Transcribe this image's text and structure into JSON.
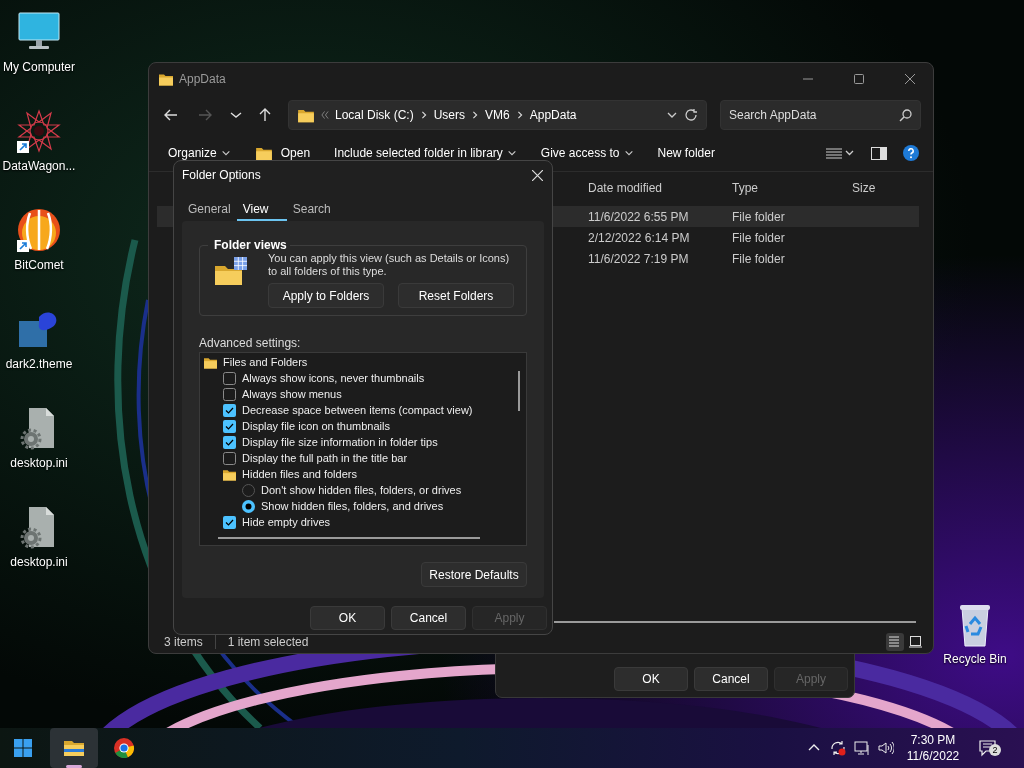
{
  "desktop_icons": [
    {
      "label": "My Computer",
      "kind": "monitor",
      "shortcut": false
    },
    {
      "label": "DataWagon...",
      "kind": "star",
      "shortcut": true
    },
    {
      "label": "BitComet",
      "kind": "comet",
      "shortcut": true
    },
    {
      "label": "dark2.theme",
      "kind": "theme",
      "shortcut": false
    },
    {
      "label": "desktop.ini",
      "kind": "settings-file",
      "shortcut": false
    },
    {
      "label": "desktop.ini",
      "kind": "settings-file",
      "shortcut": false
    }
  ],
  "recycle_bin": {
    "label": "Recycle Bin"
  },
  "background_dialog": {
    "buttons": [
      {
        "label": "OK",
        "disabled": false
      },
      {
        "label": "Cancel",
        "disabled": false
      },
      {
        "label": "Apply",
        "disabled": true
      }
    ]
  },
  "explorer": {
    "title": "AppData",
    "nav_buttons": [
      {
        "kind": "back",
        "disabled": false
      },
      {
        "kind": "forward",
        "disabled": true
      },
      {
        "kind": "recent",
        "disabled": false
      },
      {
        "kind": "up",
        "disabled": false
      }
    ],
    "breadcrumb": [
      "Local Disk (C:)",
      "Users",
      "VM6",
      "AppData"
    ],
    "search": {
      "placeholder": "Search AppData"
    },
    "commands": [
      {
        "label": "Organize",
        "kind": "menu"
      },
      {
        "label": "Open",
        "kind": "folder"
      },
      {
        "label": "Include selected folder in library",
        "kind": "menu"
      },
      {
        "label": "Give access to",
        "kind": "menu"
      },
      {
        "label": "New folder",
        "kind": "plain"
      }
    ],
    "columns": [
      "Date modified",
      "Type",
      "Size"
    ],
    "rows": [
      {
        "date_modified": "11/6/2022 6:55 PM",
        "type": "File folder",
        "selected": true
      },
      {
        "date_modified": "2/12/2022 6:14 PM",
        "type": "File folder",
        "selected": false
      },
      {
        "date_modified": "11/6/2022 7:19 PM",
        "type": "File folder",
        "selected": false
      }
    ],
    "status": {
      "count": "3 items",
      "selection": "1 item selected"
    },
    "views": [
      {
        "kind": "details",
        "selected": true
      },
      {
        "kind": "tiles",
        "selected": false
      }
    ]
  },
  "folder_options": {
    "title": "Folder Options",
    "tabs": [
      {
        "label": "General",
        "selected": false
      },
      {
        "label": "View",
        "selected": true
      },
      {
        "label": "Search",
        "selected": false
      }
    ],
    "folder_views": {
      "heading": "Folder views",
      "text": "You can apply this view (such as Details or Icons) to all folders of this type.",
      "buttons": [
        "Apply to Folders",
        "Reset Folders"
      ]
    },
    "advanced_label": "Advanced settings:",
    "settings": [
      {
        "kind": "group",
        "label": "Files and Folders",
        "children": [
          {
            "kind": "checkbox",
            "label": "Always show icons, never thumbnails",
            "checked": false
          },
          {
            "kind": "checkbox",
            "label": "Always show menus",
            "checked": false
          },
          {
            "kind": "checkbox",
            "label": "Decrease space between items (compact view)",
            "checked": true
          },
          {
            "kind": "checkbox",
            "label": "Display file icon on thumbnails",
            "checked": true
          },
          {
            "kind": "checkbox",
            "label": "Display file size information in folder tips",
            "checked": true
          },
          {
            "kind": "checkbox",
            "label": "Display the full path in the title bar",
            "checked": false
          },
          {
            "kind": "group",
            "label": "Hidden files and folders",
            "children": [
              {
                "kind": "radio",
                "label": "Don't show hidden files, folders, or drives",
                "selected": false
              },
              {
                "kind": "radio",
                "label": "Show hidden files, folders, and drives",
                "selected": true
              }
            ]
          },
          {
            "kind": "checkbox",
            "label": "Hide empty drives",
            "checked": true
          }
        ]
      }
    ],
    "restore_button": "Restore Defaults",
    "buttons": [
      {
        "label": "OK",
        "disabled": false
      },
      {
        "label": "Cancel",
        "disabled": false
      },
      {
        "label": "Apply",
        "disabled": true
      }
    ]
  },
  "taskbar": {
    "apps": [
      {
        "kind": "file-explorer",
        "selected": true
      },
      {
        "kind": "browser",
        "selected": false
      }
    ],
    "time": "7:30 PM",
    "date": "11/6/2022",
    "notification_count": "2"
  }
}
